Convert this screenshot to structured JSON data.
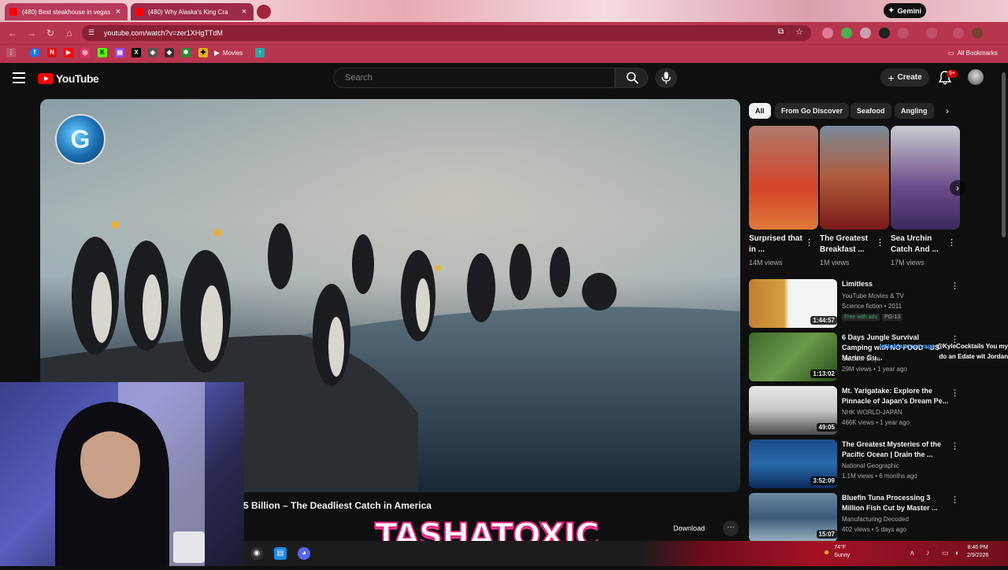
{
  "browser": {
    "tabs": [
      {
        "title": "(480) Best steakhouse in vegas"
      },
      {
        "title": "(480) Why Alaska's King Cra"
      }
    ],
    "gemini_label": "Gemini",
    "url": "youtube.com/watch?v=zer1XHgTTdM",
    "bookmarks": {
      "movies": "Movies",
      "all": "All Bookmarks"
    }
  },
  "youtube": {
    "logo": "YouTube",
    "search_placeholder": "Search",
    "create_label": "Create",
    "notif_count": "9+",
    "video": {
      "title": "5 Billion – The Deadliest Catch in America",
      "download_label": "Download",
      "more_label": "···",
      "watermark_letter": "G"
    },
    "chips": [
      "All",
      "From Go Discover",
      "Seafood",
      "Angling"
    ],
    "shorts": [
      {
        "title": "Surprised that in ...",
        "views": "14M views"
      },
      {
        "title": "The Greatest Breakfast ...",
        "views": "1M views"
      },
      {
        "title": "Sea Urchin Catch And ...",
        "views": "17M views"
      }
    ],
    "recs": [
      {
        "title": "Limitless",
        "channel": "YouTube Movies & TV",
        "meta": "Science fiction • 2011",
        "tag1": "Free with ads",
        "tag2": "PG-13",
        "duration": "1:44:57"
      },
      {
        "title": "6 Days Jungle Survival Camping with NO FOOD - US Marine Gu...",
        "channel": "Outdoor Boys",
        "meta": "29M views • 1 year ago",
        "duration": "1:13:02"
      },
      {
        "title": "Mt. Yarigatake: Explore the Pinnacle of Japan's Dream Pe...",
        "channel": "NHK WORLD-JAPAN",
        "meta": "466K views • 1 year ago",
        "duration": "49:05"
      },
      {
        "title": "The Greatest Mysteries of the Pacific Ocean | Drain the ...",
        "channel": "National Geographic",
        "meta": "1.1M views • 6 months ago",
        "duration": "3:52:09"
      },
      {
        "title": "Bluefin Tuna Processing 3 Million Fish Cut by Master ...",
        "channel": "Manufacturing Decoded",
        "meta": "402 views • 5 days ago",
        "duration": "15:07"
      }
    ]
  },
  "stream": {
    "overlay_name": "TASHATOXIC",
    "chat_user": "lottoblancesavage",
    "chat_text1": "@KyleCocktails You my",
    "chat_text2": "do an Edate wit Jordan"
  },
  "taskbar": {
    "temp": "74°F",
    "weather": "Sunny",
    "time": "8:46 PM",
    "date": "2/9/2026"
  }
}
